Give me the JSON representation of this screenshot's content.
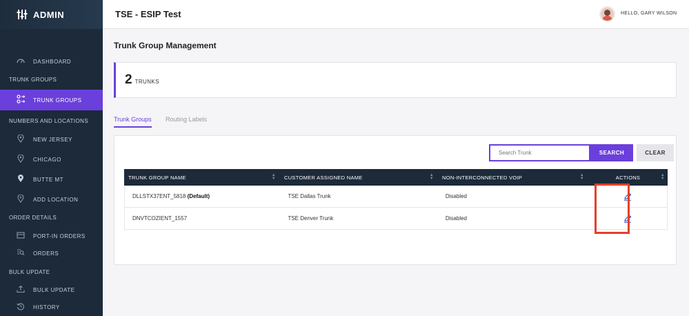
{
  "brand": {
    "title": "ADMIN"
  },
  "sidebar": {
    "items": [
      {
        "label": "DASHBOARD",
        "icon": "dashboard-gauge-icon"
      },
      {
        "label": "TRUNK GROUPS",
        "icon": "trunk-groups-icon",
        "active": true
      },
      {
        "label": "NEW JERSEY",
        "icon": "location-pin-icon"
      },
      {
        "label": "CHICAGO",
        "icon": "location-pin-icon"
      },
      {
        "label": "BUTTE MT",
        "icon": "location-pin-filled-icon"
      },
      {
        "label": "ADD LOCATION",
        "icon": "add-location-icon"
      },
      {
        "label": "PORT-IN ORDERS",
        "icon": "port-in-icon"
      },
      {
        "label": "ORDERS",
        "icon": "orders-search-icon"
      },
      {
        "label": "BULK UPDATE",
        "icon": "upload-icon"
      },
      {
        "label": "HISTORY",
        "icon": "history-icon"
      }
    ],
    "sections": [
      "TRUNK GROUPS",
      "NUMBERS AND LOCATIONS",
      "ORDER DETAILS",
      "BULK UPDATE"
    ]
  },
  "header": {
    "title": "TSE - ESIP Test",
    "greeting": "HELLO, GARY WILSON"
  },
  "main": {
    "page_title": "Trunk Group Management",
    "count": "2",
    "count_label": "TRUNKS",
    "tabs": [
      {
        "label": "Trunk Groups",
        "active": true
      },
      {
        "label": "Routing Labels",
        "active": false
      }
    ],
    "search": {
      "placeholder": "Search Trunk",
      "search_label": "SEARCH",
      "clear_label": "CLEAR"
    },
    "table": {
      "columns": [
        "TRUNK GROUP NAME",
        "CUSTOMER ASSIGNED NAME",
        "NON-INTERCONNECTED VOIP",
        "ACTIONS"
      ],
      "rows": [
        {
          "name": "DLLSTX37ENT_5818",
          "tag": "(Default)",
          "customer_name": "TSE Dallas Trunk",
          "voip": "Disabled"
        },
        {
          "name": "DNVTCOZIENT_1557",
          "tag": "",
          "customer_name": "TSE Denver Trunk",
          "voip": "Disabled"
        }
      ]
    }
  },
  "colors": {
    "accent": "#6b3fdc",
    "sidebar": "#1c2a3a",
    "highlight": "#e3402b"
  }
}
